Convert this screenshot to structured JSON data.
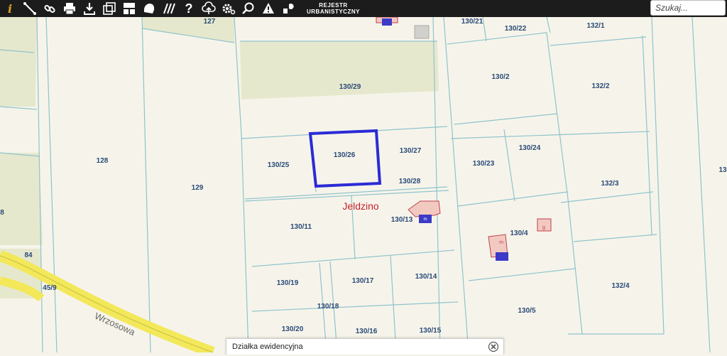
{
  "toolbar": {
    "tools": [
      {
        "icon": "info-icon"
      },
      {
        "icon": "measure-line-icon"
      },
      {
        "icon": "link-icon"
      },
      {
        "icon": "print-icon"
      },
      {
        "icon": "download-icon"
      },
      {
        "icon": "export-icon"
      },
      {
        "icon": "layout-icon"
      },
      {
        "icon": "shape-icon"
      },
      {
        "icon": "hatch-icon"
      },
      {
        "icon": "help-icon"
      },
      {
        "icon": "upload-cloud-icon"
      },
      {
        "icon": "settings-icon"
      },
      {
        "icon": "zoom-search-icon"
      },
      {
        "icon": "warning-icon"
      },
      {
        "icon": "layers-icon"
      }
    ],
    "registry_line1": "REJESTR",
    "registry_line2": "URBANISTYCZNY"
  },
  "search": {
    "placeholder": "Szukaj..."
  },
  "map": {
    "place_name": "Jeldzino",
    "street_name": "Wrzosowa",
    "parcels": [
      "127",
      "128",
      "129",
      "130/29",
      "130/21",
      "130/22",
      "132/1",
      "130/2",
      "132/2",
      "130/25",
      "130/26",
      "130/27",
      "130/28",
      "130/23",
      "130/24",
      "132/3",
      "130/11",
      "130/13",
      "130/4",
      "130/19",
      "130/17",
      "130/14",
      "132/4",
      "130/18",
      "130/5",
      "130/20",
      "130/16",
      "130/15",
      "84",
      "45/9",
      "8",
      "13"
    ],
    "selected_parcel": "130/26",
    "colors": {
      "background": "#f6f4ea",
      "parcel_line": "#8fc3cd",
      "green_area": "#e6e8cd",
      "road": "#f2e85a",
      "selection": "#2b2bd6",
      "label": "#2a4a78",
      "place": "#c8202a"
    }
  },
  "info_panel": {
    "title": "Działka ewidencyjna"
  }
}
